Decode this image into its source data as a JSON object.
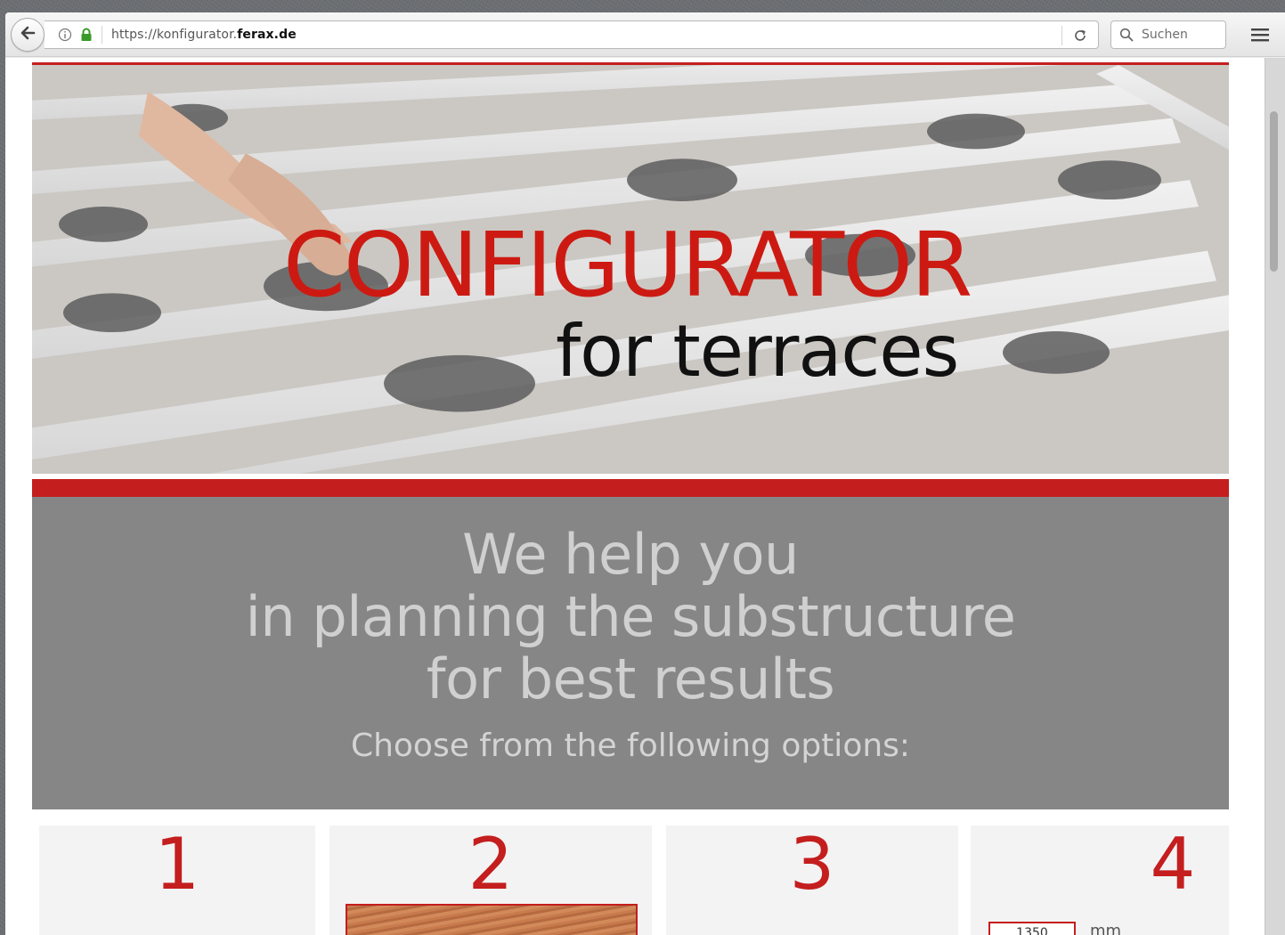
{
  "browser": {
    "url_prefix": "https://konfigurator.",
    "url_domain": "ferax.de",
    "search_placeholder": "Suchen"
  },
  "hero": {
    "title": "CONFIGURATOR",
    "subtitle": "for terraces"
  },
  "intro": {
    "line1": "We help you",
    "line2": "in planning the substructure",
    "line3": "for best results",
    "choose": "Choose from the following options:"
  },
  "options": [
    {
      "number": "1"
    },
    {
      "number": "2"
    },
    {
      "number": "3"
    },
    {
      "number": "4",
      "value": "1350",
      "unit": "mm"
    }
  ],
  "colors": {
    "accent_red": "#c41e1e",
    "band_gray": "#868686"
  },
  "icons": [
    "back-arrow-icon",
    "info-icon",
    "lock-icon",
    "reload-icon",
    "search-icon",
    "hamburger-menu-icon"
  ]
}
